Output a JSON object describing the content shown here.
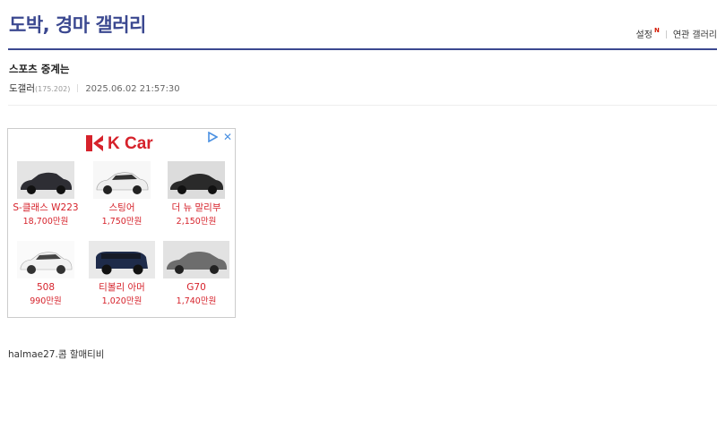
{
  "header": {
    "gallery_title": "도박, 경마 갤러리",
    "settings_label": "설정",
    "new_badge": "N",
    "related_label": "연관 갤러리"
  },
  "post": {
    "title": "스포츠 중계는",
    "author": "도갤러",
    "ip": "(175.202)",
    "date": "2025.06.02 21:57:30",
    "content": "halmae27.콤 할매티비"
  },
  "ad": {
    "brand": "K Car",
    "accent_color": "#d6222b",
    "cars": [
      {
        "name": "S-클래스 W223",
        "price": "18,700만원",
        "body_color": "#2e2e34"
      },
      {
        "name": "스팅어",
        "price": "1,750만원",
        "body_color": "#eeeeee"
      },
      {
        "name": "더 뉴 말리부",
        "price": "2,150만원",
        "body_color": "#2a2a2a"
      },
      {
        "name": "508",
        "price": "990만원",
        "body_color": "#f2f2f2"
      },
      {
        "name": "티볼리 아머",
        "price": "1,020만원",
        "body_color": "#1e2b4a"
      },
      {
        "name": "G70",
        "price": "1,740만원",
        "body_color": "#6d6d6d"
      }
    ]
  }
}
